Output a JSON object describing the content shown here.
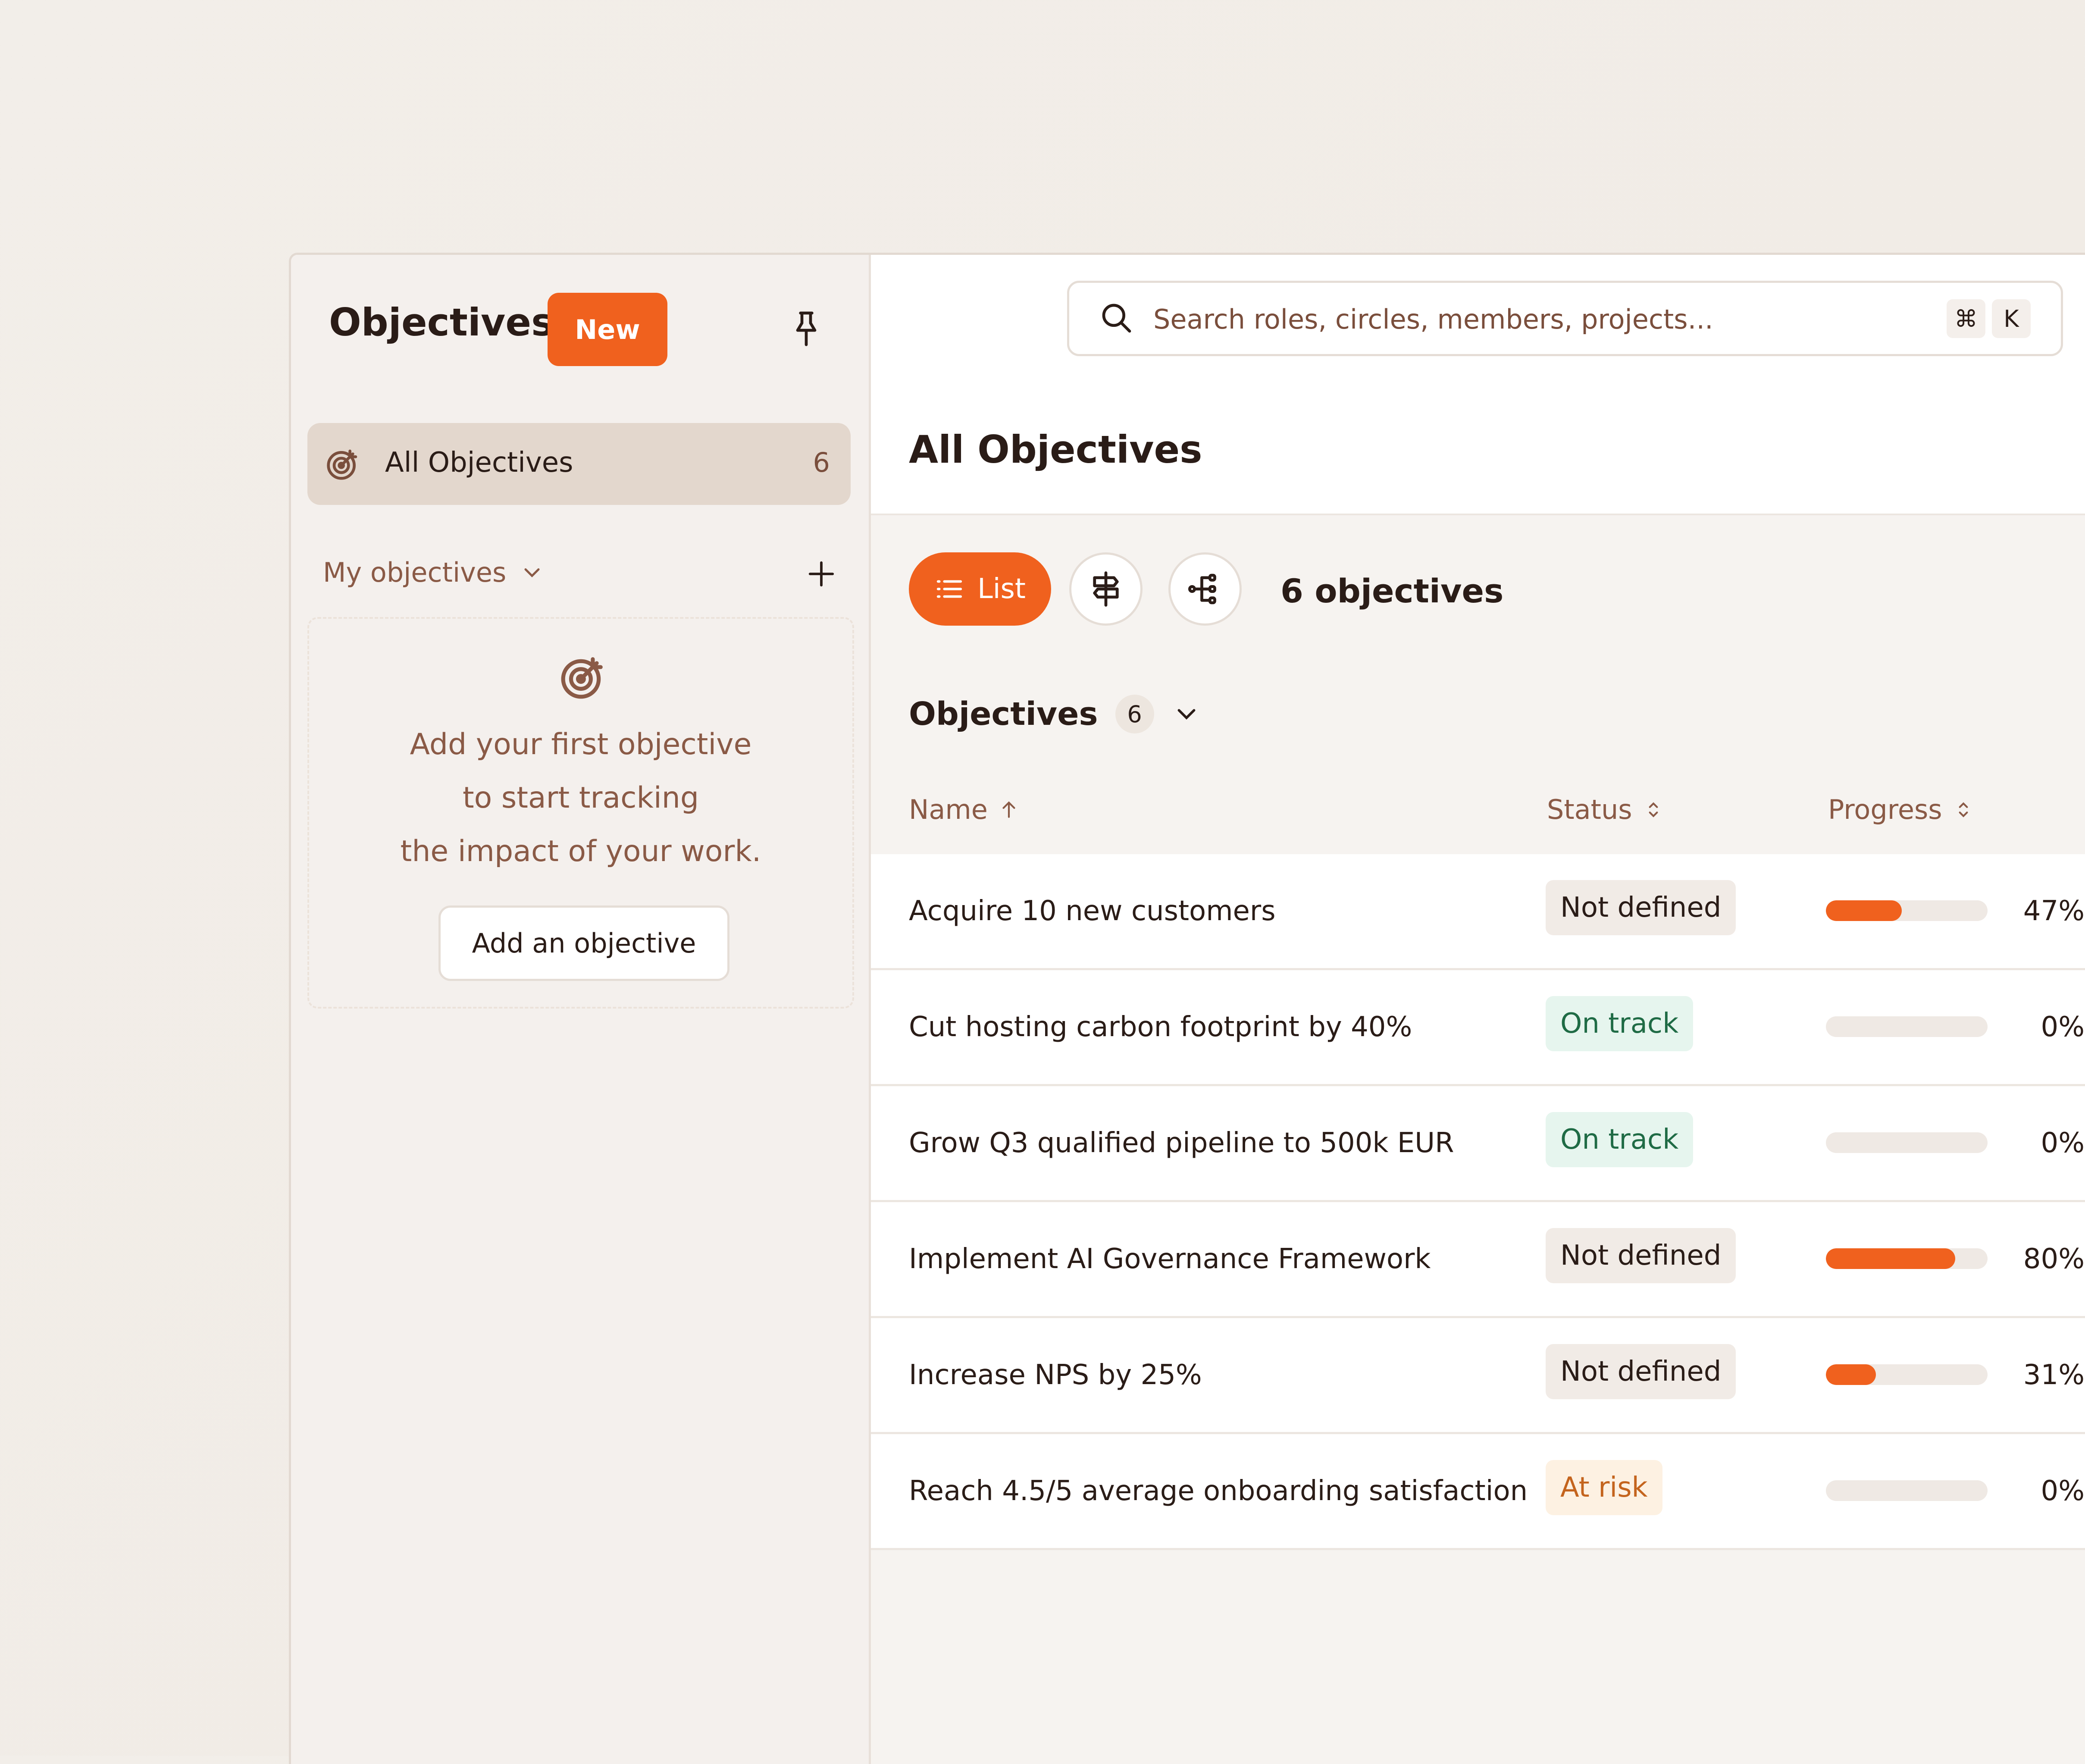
{
  "sidebar": {
    "title": "Objectives",
    "new_label": "New",
    "all_objectives": {
      "label": "All Objectives",
      "count": "6"
    },
    "my_objectives_label": "My objectives",
    "empty": {
      "line1": "Add your first objective",
      "line2": "to start tracking",
      "line3": "the impact of your work.",
      "button": "Add an objective"
    }
  },
  "search": {
    "placeholder": "Search roles, circles, members, projects...",
    "kbd1": "⌘",
    "kbd2": "K"
  },
  "main": {
    "title": "All Objectives",
    "view_list_label": "List",
    "count_label": "6 objectives",
    "section_title": "Objectives",
    "section_count": "6",
    "columns": {
      "name": "Name",
      "status": "Status",
      "progress": "Progress"
    },
    "rows": [
      {
        "name": "Acquire 10 new customers",
        "status": "Not defined",
        "status_kind": "nd",
        "progress": 47,
        "progress_label": "47%"
      },
      {
        "name": "Cut hosting carbon footprint by 40%",
        "status": "On track",
        "status_kind": "ok",
        "progress": 0,
        "progress_label": "0%"
      },
      {
        "name": "Grow Q3 qualified pipeline to 500k EUR",
        "status": "On track",
        "status_kind": "ok",
        "progress": 0,
        "progress_label": "0%"
      },
      {
        "name": "Implement AI Governance Framework",
        "status": "Not defined",
        "status_kind": "nd",
        "progress": 80,
        "progress_label": "80%"
      },
      {
        "name": "Increase NPS by 25%",
        "status": "Not defined",
        "status_kind": "nd",
        "progress": 31,
        "progress_label": "31%"
      },
      {
        "name": "Reach 4.5/5 average onboarding satisfaction",
        "status": "At risk",
        "status_kind": "risk",
        "progress": 0,
        "progress_label": "0%"
      }
    ]
  },
  "colors": {
    "accent": "#f0611e",
    "on_track": "#1f6b45",
    "at_risk": "#c4641d"
  }
}
